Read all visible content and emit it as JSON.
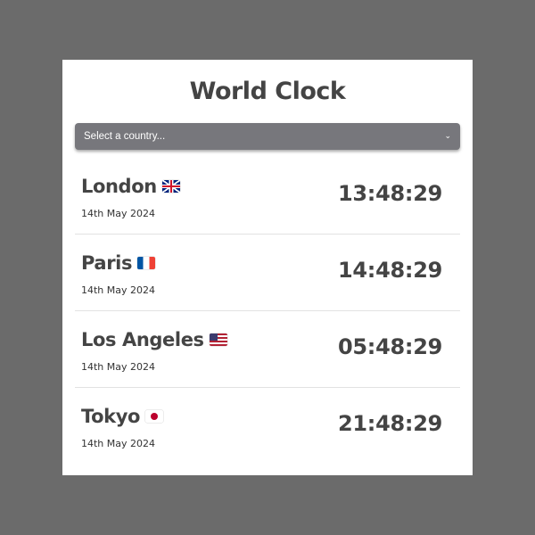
{
  "app": {
    "title": "World Clock"
  },
  "selector": {
    "placeholder": "Select a country...",
    "icon": "chevron-down-icon"
  },
  "clocks": [
    {
      "city": "London",
      "flag": "uk-flag-icon",
      "date": "14th May 2024",
      "time": "13:48:29"
    },
    {
      "city": "Paris",
      "flag": "france-flag-icon",
      "date": "14th May 2024",
      "time": "14:48:29"
    },
    {
      "city": "Los Angeles",
      "flag": "us-flag-icon",
      "date": "14th May 2024",
      "time": "05:48:29"
    },
    {
      "city": "Tokyo",
      "flag": "japan-flag-icon",
      "date": "14th May 2024",
      "time": "21:48:29"
    }
  ],
  "colors": {
    "background": "#6b6b6b",
    "card": "#ffffff",
    "select": "#77777c",
    "text": "#444444"
  }
}
